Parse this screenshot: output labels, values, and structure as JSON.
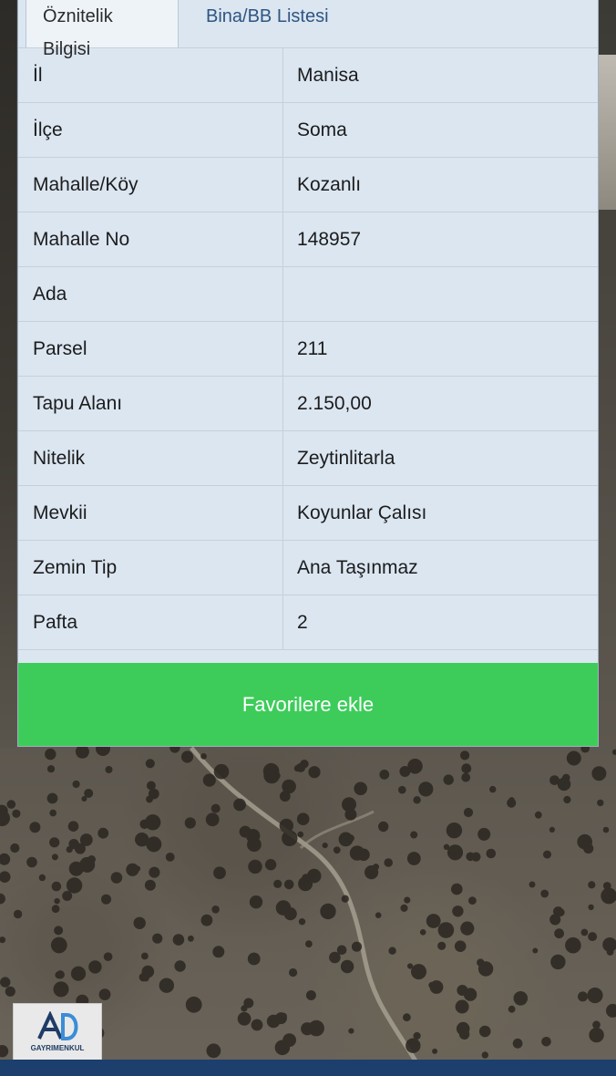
{
  "tabs": {
    "active": "Öznitelik Bilgisi",
    "inactive": "Bina/BB Listesi"
  },
  "rows": [
    {
      "key": "İl",
      "value": "Manisa"
    },
    {
      "key": "İlçe",
      "value": "Soma"
    },
    {
      "key": "Mahalle/Köy",
      "value": "Kozanlı"
    },
    {
      "key": "Mahalle No",
      "value": "148957"
    },
    {
      "key": "Ada",
      "value": ""
    },
    {
      "key": "Parsel",
      "value": "211"
    },
    {
      "key": "Tapu Alanı",
      "value": "2.150,00"
    },
    {
      "key": "Nitelik",
      "value": "Zeytinlitarla"
    },
    {
      "key": "Mevkii",
      "value": "Koyunlar Çalısı"
    },
    {
      "key": "Zemin Tip",
      "value": "Ana Taşınmaz"
    },
    {
      "key": "Pafta",
      "value": "2"
    }
  ],
  "favorite_button": {
    "label": "Favorilere ekle"
  },
  "logo": {
    "text": "GAYRIMENKUL"
  },
  "colors": {
    "panel": "#dbe6f1",
    "button": "#3dcc5a",
    "row_border": "#c4d0dc"
  }
}
